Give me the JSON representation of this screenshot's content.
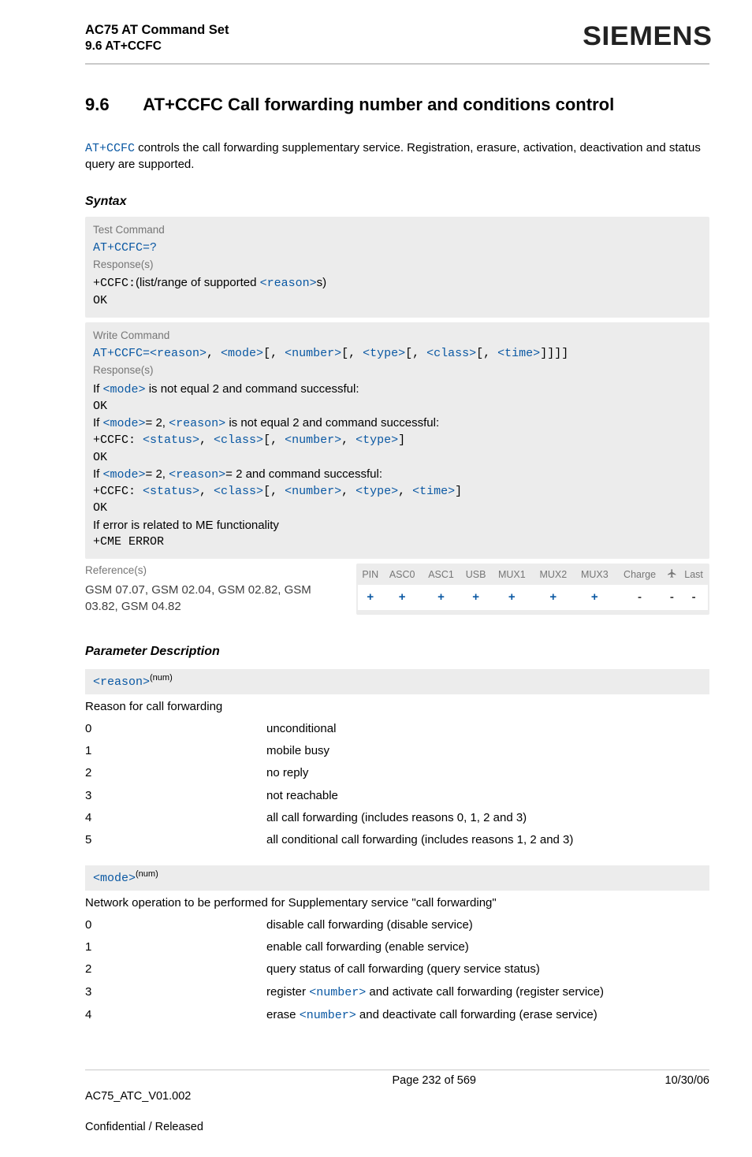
{
  "header": {
    "title": "AC75 AT Command Set",
    "subtitle": "9.6 AT+CCFC",
    "brand": "SIEMENS"
  },
  "section": {
    "number": "9.6",
    "title": "AT+CCFC   Call forwarding number and conditions control"
  },
  "intro": {
    "cmd": "AT+CCFC",
    "text_after": " controls the call forwarding supplementary service. Registration, erasure, activation, deactivation and status query are supported."
  },
  "syntax": {
    "label": "Syntax",
    "test": {
      "hdr": "Test Command",
      "cmd": "AT+CCFC=?",
      "resp_hdr": "Response(s)",
      "resp_prefix": "+CCFC:",
      "resp_mid": "(list/range of supported ",
      "resp_param": "<reason>",
      "resp_suffix": "s)",
      "ok": "OK"
    },
    "write": {
      "hdr": "Write Command",
      "cmd_prefix": "AT+CCFC=",
      "params": [
        "<reason>",
        "<mode>",
        "<number>",
        "<type>",
        "<class>",
        "<time>"
      ],
      "resp_hdr": "Response(s)",
      "r1a": "If ",
      "r1p": "<mode>",
      "r1b": " is not equal 2 and command successful:",
      "ok": "OK",
      "r2a": "If ",
      "r2p1": "<mode>",
      "r2b": "= 2, ",
      "r2p2": "<reason>",
      "r2c": " is not equal 2 and command successful:",
      "r2_cmd": "+CCFC: ",
      "r2_params": [
        "<status>",
        "<class>",
        "<number>",
        "<type>"
      ],
      "r3a": "If ",
      "r3p1": "<mode>",
      "r3b": "= 2, ",
      "r3p2": "<reason>",
      "r3c": "= 2 and command successful:",
      "r3_cmd": "+CCFC: ",
      "r3_params": [
        "<status>",
        "<class>",
        "<number>",
        "<type>",
        "<time>"
      ],
      "err_line": "If error is related to ME functionality",
      "err_cmd": "+CME ERROR"
    }
  },
  "reference": {
    "hdr": "Reference(s)",
    "body": "GSM 07.07, GSM 02.04, GSM 02.82, GSM 03.82, GSM 04.82",
    "cols": [
      "PIN",
      "ASC0",
      "ASC1",
      "USB",
      "MUX1",
      "MUX2",
      "MUX3",
      "Charge",
      "air",
      "Last"
    ],
    "vals": [
      "+",
      "+",
      "+",
      "+",
      "+",
      "+",
      "+",
      "-",
      "-",
      "-"
    ]
  },
  "params_label": "Parameter Description",
  "param_reason": {
    "name": "<reason>",
    "type": "(num)",
    "desc": "Reason for call forwarding",
    "items": [
      {
        "k": "0",
        "v": "unconditional"
      },
      {
        "k": "1",
        "v": "mobile busy"
      },
      {
        "k": "2",
        "v": "no reply"
      },
      {
        "k": "3",
        "v": "not reachable"
      },
      {
        "k": "4",
        "v": "all call forwarding (includes reasons 0, 1, 2 and 3)"
      },
      {
        "k": "5",
        "v": "all conditional call forwarding (includes reasons 1, 2 and 3)"
      }
    ]
  },
  "param_mode": {
    "name": "<mode>",
    "type": "(num)",
    "desc": "Network operation to be performed for Supplementary service \"call forwarding\"",
    "items": [
      {
        "k": "0",
        "v": "disable call forwarding (disable service)"
      },
      {
        "k": "1",
        "v": "enable call forwarding (enable service)"
      },
      {
        "k": "2",
        "v": "query status of call forwarding (query service status)"
      },
      {
        "k": "3",
        "v_pre": "register ",
        "v_param": "<number>",
        "v_post": " and activate call forwarding (register service)"
      },
      {
        "k": "4",
        "v_pre": "erase ",
        "v_param": "<number>",
        "v_post": " and deactivate call forwarding (erase service)"
      }
    ]
  },
  "footer": {
    "left1": "AC75_ATC_V01.002",
    "left2": "Confidential / Released",
    "center": "Page 232 of 569",
    "right": "10/30/06"
  }
}
